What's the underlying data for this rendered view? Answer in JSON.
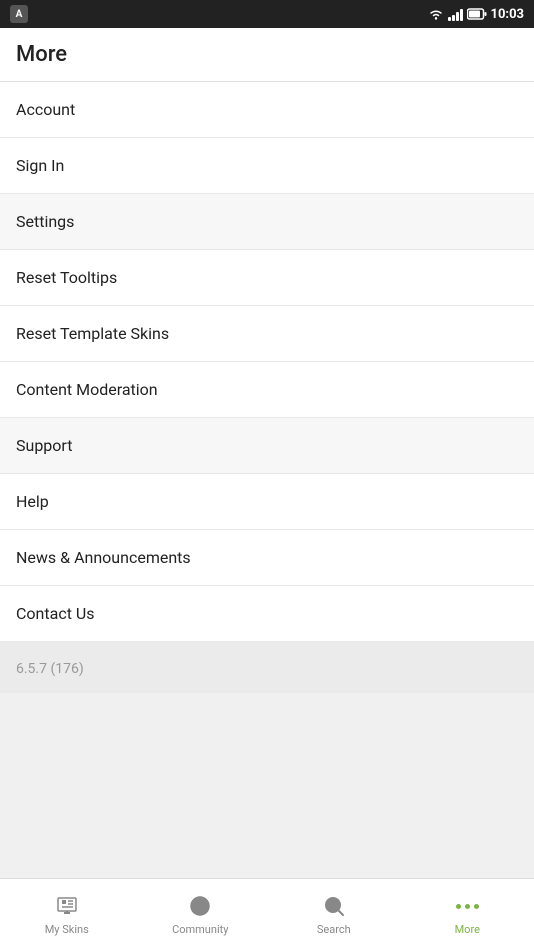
{
  "statusBar": {
    "time": "10:03"
  },
  "header": {
    "title": "More"
  },
  "menu": {
    "items": [
      {
        "id": "account",
        "label": "Account",
        "shaded": false
      },
      {
        "id": "sign-in",
        "label": "Sign In",
        "shaded": false
      },
      {
        "id": "settings",
        "label": "Settings",
        "shaded": true
      },
      {
        "id": "reset-tooltips",
        "label": "Reset Tooltips",
        "shaded": false
      },
      {
        "id": "reset-template-skins",
        "label": "Reset Template Skins",
        "shaded": false
      },
      {
        "id": "content-moderation",
        "label": "Content Moderation",
        "shaded": false
      },
      {
        "id": "support",
        "label": "Support",
        "shaded": true
      },
      {
        "id": "help",
        "label": "Help",
        "shaded": false
      },
      {
        "id": "news-announcements",
        "label": "News & Announcements",
        "shaded": false
      },
      {
        "id": "contact-us",
        "label": "Contact Us",
        "shaded": false
      }
    ]
  },
  "version": {
    "text": "6.5.7 (176)"
  },
  "bottomNav": {
    "items": [
      {
        "id": "my-skins",
        "label": "My Skins",
        "active": false
      },
      {
        "id": "community",
        "label": "Community",
        "active": false
      },
      {
        "id": "search",
        "label": "Search",
        "active": false
      },
      {
        "id": "more",
        "label": "More",
        "active": true
      }
    ]
  }
}
